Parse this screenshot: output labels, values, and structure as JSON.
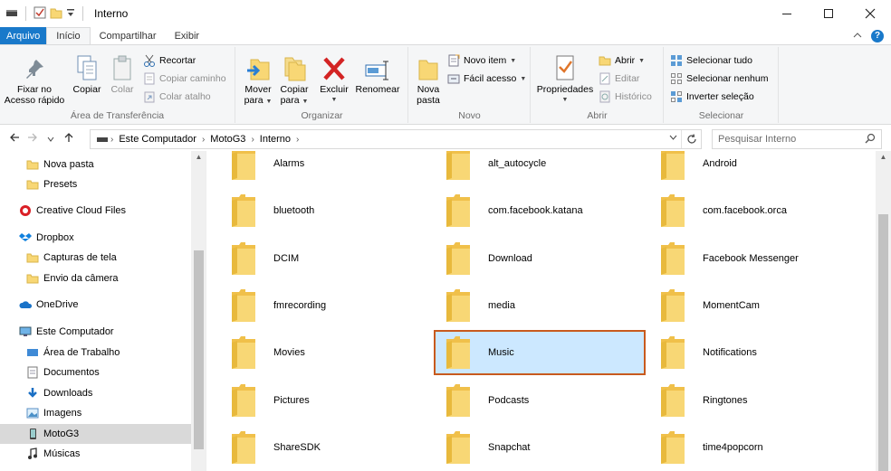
{
  "window": {
    "title": "Interno"
  },
  "ribbon_tabs": {
    "file": "Arquivo",
    "home": "Início",
    "share": "Compartilhar",
    "view": "Exibir"
  },
  "clipboard": {
    "label": "Área de Transferência",
    "pin": "Fixar no Acesso rápido",
    "copy": "Copiar",
    "paste": "Colar",
    "cut": "Recortar",
    "copy_path": "Copiar caminho",
    "paste_shortcut": "Colar atalho"
  },
  "organize": {
    "label": "Organizar",
    "move_to_1": "Mover",
    "move_to_2": "para",
    "copy_to_1": "Copiar",
    "copy_to_2": "para",
    "delete": "Excluir",
    "rename": "Renomear"
  },
  "new": {
    "label": "Novo",
    "new_folder_1": "Nova",
    "new_folder_2": "pasta",
    "new_item": "Novo item",
    "easy_access": "Fácil acesso"
  },
  "open": {
    "label": "Abrir",
    "properties": "Propriedades",
    "open": "Abrir",
    "edit": "Editar",
    "history": "Histórico"
  },
  "select": {
    "label": "Selecionar",
    "select_all": "Selecionar tudo",
    "select_none": "Selecionar nenhum",
    "invert": "Inverter seleção"
  },
  "address": {
    "crumbs": [
      "Este Computador",
      "MotoG3",
      "Interno"
    ]
  },
  "search": {
    "placeholder": "Pesquisar Interno"
  },
  "nav": [
    {
      "label": "Nova pasta",
      "icon": "folder-icon"
    },
    {
      "label": "Presets",
      "icon": "folder-icon"
    },
    {
      "label": "Creative Cloud Files",
      "icon": "creative-cloud-icon"
    },
    {
      "label": "Dropbox",
      "icon": "dropbox-icon"
    },
    {
      "label": "Capturas de tela",
      "icon": "folder-icon"
    },
    {
      "label": "Envio da câmera",
      "icon": "folder-icon"
    },
    {
      "label": "OneDrive",
      "icon": "onedrive-icon"
    },
    {
      "label": "Este Computador",
      "icon": "computer-icon"
    },
    {
      "label": "Área de Trabalho",
      "icon": "desktop-icon"
    },
    {
      "label": "Documentos",
      "icon": "documents-icon"
    },
    {
      "label": "Downloads",
      "icon": "downloads-icon"
    },
    {
      "label": "Imagens",
      "icon": "pictures-icon"
    },
    {
      "label": "MotoG3",
      "icon": "phone-icon"
    },
    {
      "label": "Músicas",
      "icon": "music-icon"
    }
  ],
  "folders": [
    "Alarms",
    "alt_autocycle",
    "Android",
    "bluetooth",
    "com.facebook.katana",
    "com.facebook.orca",
    "DCIM",
    "Download",
    "Facebook Messenger",
    "fmrecording",
    "media",
    "MomentCam",
    "Movies",
    "Music",
    "Notifications",
    "Pictures",
    "Podcasts",
    "Ringtones",
    "ShareSDK",
    "Snapchat",
    "time4popcorn"
  ],
  "selected_folder": "Music",
  "colors": {
    "accent": "#1979ca",
    "selection": "#cce8ff",
    "highlight_border": "#c85a1e",
    "folder": "#f8d775"
  }
}
